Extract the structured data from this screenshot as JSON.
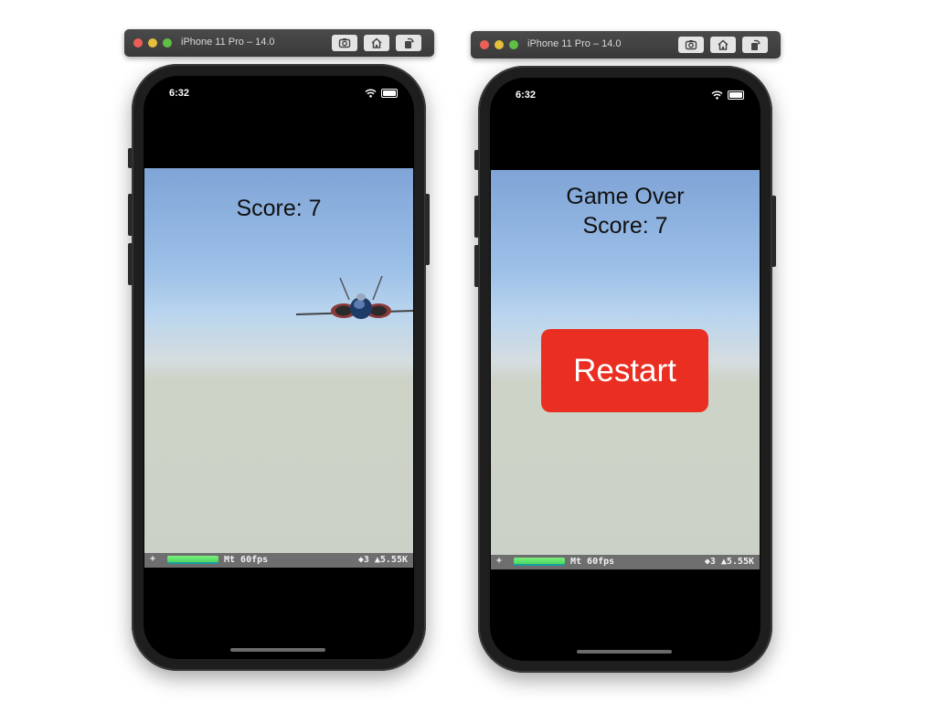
{
  "simulators": [
    {
      "window_title": "iPhone 11 Pro – 14.0",
      "status_time": "6:32",
      "score_label": "Score: 7",
      "hud": {
        "plus": "+",
        "fps": "Mt 60fps",
        "stats": "◆3 ▲5.55K"
      }
    },
    {
      "window_title": "iPhone 11 Pro – 14.0",
      "status_time": "6:32",
      "game_over_label": "Game Over",
      "score_label": "Score: 7",
      "restart_label": "Restart",
      "hud": {
        "plus": "+",
        "fps": "Mt 60fps",
        "stats": "◆3 ▲5.55K"
      }
    }
  ],
  "toolbar_icons": [
    "screenshot-icon",
    "home-icon",
    "rotate-icon"
  ],
  "colors": {
    "restart": "#ea2f22",
    "sky_top": "#7fa4d6",
    "ground": "#cad2c7"
  }
}
